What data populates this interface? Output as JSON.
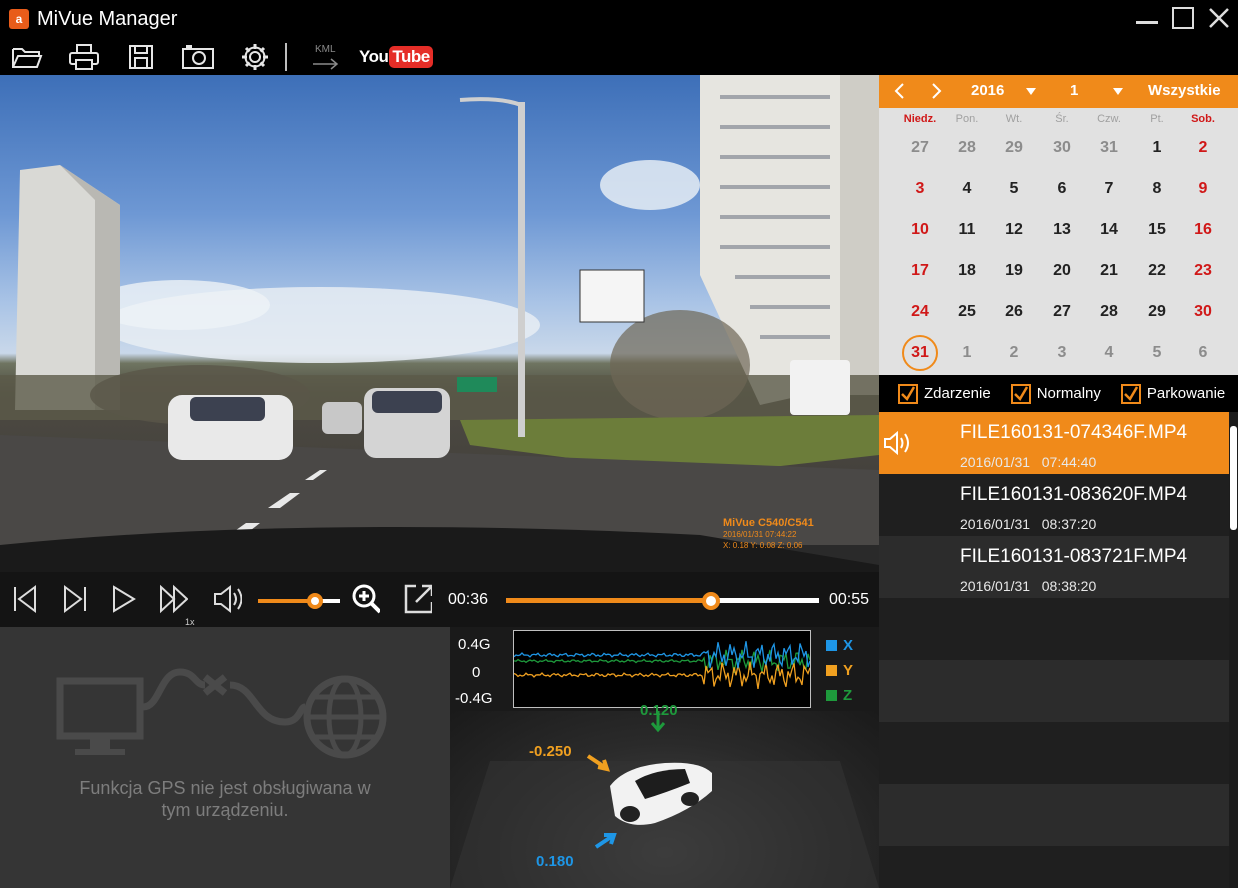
{
  "app": {
    "title": "MiVue Manager",
    "logo_text": "a"
  },
  "toolbar": {
    "kml_label": "KML",
    "youtube_you": "You",
    "youtube_tube": "Tube"
  },
  "video": {
    "overlay_model": "MiVue C540/C541",
    "overlay_datetime": "2016/01/31 07:44:22",
    "overlay_gsensor": "X: 0.18   Y: 0.08   Z: 0.06"
  },
  "player": {
    "current_time": "00:36",
    "total_time": "00:55",
    "speed_label": "1x",
    "volume_level": 0.7,
    "seek_progress": 0.655
  },
  "gps": {
    "message_line1": "Funkcja GPS nie jest obsługiwana w",
    "message_line2": "tym urządzeniu."
  },
  "gsensor": {
    "y_labels": [
      "0.4G",
      "0",
      "-0.4G"
    ],
    "legend": [
      {
        "name": "X",
        "color": "#1e96e6"
      },
      {
        "name": "Y",
        "color": "#f0a020"
      },
      {
        "name": "Z",
        "color": "#1e9a3c"
      }
    ],
    "axis_values": {
      "z": "0.120",
      "y": "-0.250",
      "x": "0.180"
    }
  },
  "calendar": {
    "year": "2016",
    "month": "1",
    "filter": "Wszystkie",
    "weekdays": [
      "Niedz.",
      "Pon.",
      "Wt.",
      "Śr.",
      "Czw.",
      "Pt.",
      "Sob."
    ],
    "weeks": [
      [
        "27",
        "28",
        "29",
        "30",
        "31",
        "1",
        "2"
      ],
      [
        "3",
        "4",
        "5",
        "6",
        "7",
        "8",
        "9"
      ],
      [
        "10",
        "11",
        "12",
        "13",
        "14",
        "15",
        "16"
      ],
      [
        "17",
        "18",
        "19",
        "20",
        "21",
        "22",
        "23"
      ],
      [
        "24",
        "25",
        "26",
        "27",
        "28",
        "29",
        "30"
      ],
      [
        "31",
        "1",
        "2",
        "3",
        "4",
        "5",
        "6"
      ]
    ],
    "today": "31"
  },
  "filters": [
    {
      "label": "Zdarzenie",
      "checked": true
    },
    {
      "label": "Normalny",
      "checked": true
    },
    {
      "label": "Parkowanie",
      "checked": true
    }
  ],
  "files": [
    {
      "name": "FILE160131-074346F.MP4",
      "date": "2016/01/31",
      "time": "07:44:40",
      "selected": true
    },
    {
      "name": "FILE160131-083620F.MP4",
      "date": "2016/01/31",
      "time": "08:37:20",
      "selected": false
    },
    {
      "name": "FILE160131-083721F.MP4",
      "date": "2016/01/31",
      "time": "08:38:20",
      "selected": false
    }
  ],
  "colors": {
    "accent": "#f08a1a",
    "weekend": "#d01818"
  }
}
